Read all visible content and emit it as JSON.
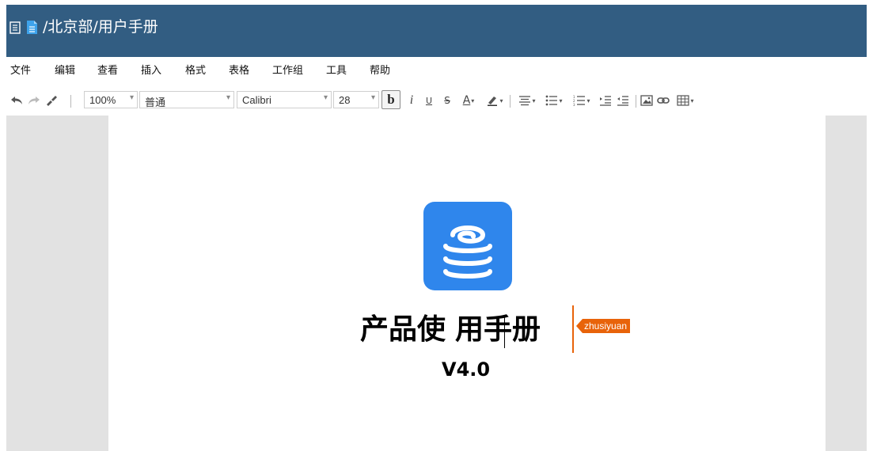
{
  "window": {
    "title": "/北京部/用户手册"
  },
  "menubar": {
    "items": [
      "文件",
      "编辑",
      "查看",
      "插入",
      "格式",
      "表格",
      "工作组",
      "工具",
      "帮助"
    ]
  },
  "toolbar": {
    "zoom": "100%",
    "paragraph_style": "普通",
    "font_family": "Calibri",
    "font_size": "28",
    "bold_label": "b",
    "italic_label": "i",
    "underline_label": "U",
    "strike_label": "S",
    "font_color_label": "A",
    "icons": [
      "undo-icon",
      "redo-icon",
      "format-painter-icon",
      "bold-icon",
      "italic-icon",
      "underline-icon",
      "strikethrough-icon",
      "font-color-icon",
      "highlight-icon",
      "align-icon",
      "bullet-list-icon",
      "numbered-list-icon",
      "indent-increase-icon",
      "indent-decrease-icon",
      "insert-image-icon",
      "link-icon",
      "table-icon"
    ]
  },
  "document": {
    "title_part1": "产品使",
    "title_part2": "用手册",
    "version": "V4.0",
    "collaborator": "zhusiyuan"
  },
  "colors": {
    "titlebar": "#325d82",
    "logo": "#2f86ec",
    "collaborator": "#e8630a",
    "canvas": "#e2e2e2"
  }
}
